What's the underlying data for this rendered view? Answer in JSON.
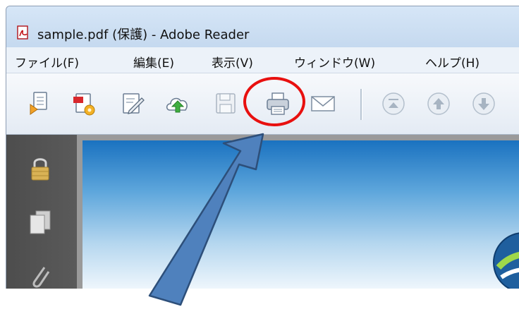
{
  "window": {
    "title": "sample.pdf (保護) - Adobe Reader"
  },
  "menubar": {
    "items": [
      {
        "label": "ファイル(F)"
      },
      {
        "label": "編集(E)"
      },
      {
        "label": "表示(V)"
      },
      {
        "label": "ウィンドウ(W)"
      },
      {
        "label": "ヘルプ(H)"
      }
    ]
  },
  "toolbar": {
    "tools": [
      {
        "icon": "open-document-icon"
      },
      {
        "icon": "create-pdf-icon"
      },
      {
        "icon": "edit-document-icon"
      },
      {
        "icon": "cloud-upload-icon"
      },
      {
        "icon": "save-icon"
      },
      {
        "icon": "print-icon"
      },
      {
        "icon": "email-icon"
      },
      {
        "icon": "first-page-icon"
      },
      {
        "icon": "previous-page-icon"
      },
      {
        "icon": "next-page-icon"
      }
    ]
  },
  "sidebar": {
    "icons": [
      "lock-icon",
      "pages-icon",
      "attachments-icon"
    ]
  },
  "annotation": {
    "highlight_color": "#e8100f",
    "arrow_color": "#4f81bd",
    "arrow_stroke": "#2d4f7a"
  }
}
